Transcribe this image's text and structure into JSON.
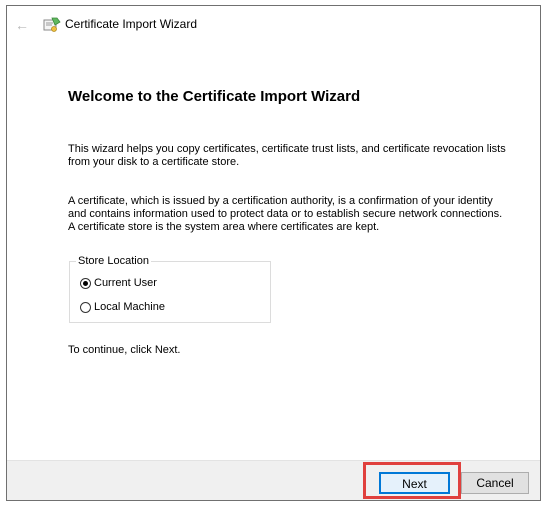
{
  "window": {
    "title": "Certificate Import Wizard"
  },
  "content": {
    "heading": "Welcome to the Certificate Import Wizard",
    "intro": "This wizard helps you copy certificates, certificate trust lists, and certificate revocation lists from your disk to a certificate store.",
    "description": "A certificate, which is issued by a certification authority, is a confirmation of your identity and contains information used to protect data or to establish secure network connections. A certificate store is the system area where certificates are kept.",
    "store_location": {
      "legend": "Store Location",
      "options": [
        {
          "label": "Current User",
          "checked": true
        },
        {
          "label": "Local Machine",
          "checked": false
        }
      ]
    },
    "continue_text": "To continue, click Next."
  },
  "footer": {
    "next_label": "Next",
    "cancel_label": "Cancel"
  },
  "icons": {
    "back": "back-arrow-icon",
    "title": "certificate-icon"
  },
  "colors": {
    "highlight": "#e0403d",
    "focus": "#0078d7"
  }
}
